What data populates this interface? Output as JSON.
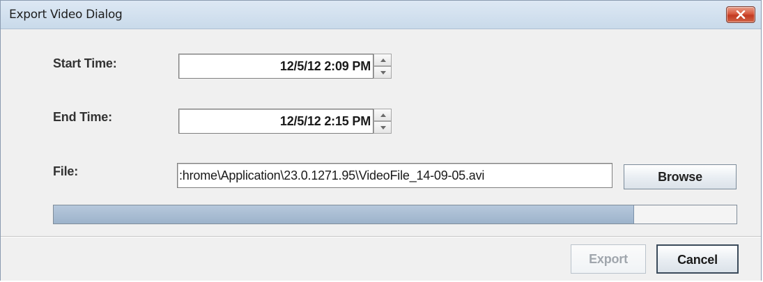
{
  "window": {
    "title": "Export Video Dialog"
  },
  "icons": {
    "close": "close-icon",
    "spin_up": "arrow-up-icon",
    "spin_down": "arrow-down-icon"
  },
  "form": {
    "start_time_label": "Start Time:",
    "start_time_value": "12/5/12 2:09 PM",
    "end_time_label": "End Time:",
    "end_time_value": "12/5/12 2:15 PM",
    "file_label": "File:",
    "file_value": ":hrome\\Application\\23.0.1271.95\\VideoFile_14-09-05.avi",
    "browse_label": "Browse"
  },
  "progress": {
    "fraction": 0.85
  },
  "footer": {
    "export_label": "Export",
    "export_enabled": false,
    "cancel_label": "Cancel"
  },
  "colors": {
    "titlebar": "#c9daea",
    "close_button": "#c23a22",
    "progress_fill": "#9db3cb"
  }
}
